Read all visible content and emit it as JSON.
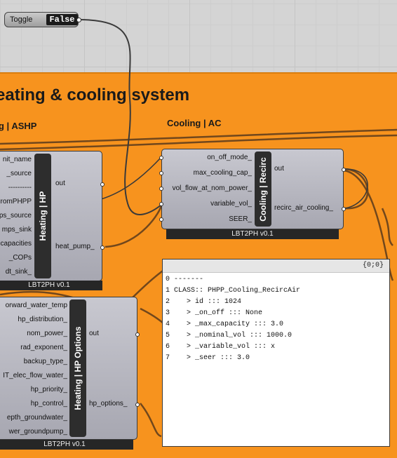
{
  "toggle": {
    "label": "Toggle",
    "value": "False"
  },
  "group": {
    "title": "eating & cooling system",
    "left_subtitle": "g | ASHP",
    "right_subtitle": "Cooling | AC"
  },
  "heating_hp": {
    "inputs": [
      "nit_name",
      "_source",
      "----------",
      "romPHPP",
      "ps_source",
      "mps_sink",
      "capacities",
      "_COPs",
      "dt_sink_"
    ],
    "outputs": [
      "out",
      "heat_pump_"
    ],
    "title": "Heating | HP",
    "footer": "LBT2PH v0.1"
  },
  "cooling_recirc": {
    "inputs": [
      "on_off_mode_",
      "max_cooling_cap_",
      "vol_flow_at_nom_power_",
      "variable_vol_",
      "SEER_"
    ],
    "outputs": [
      "out",
      "recirc_air_cooling_"
    ],
    "title": "Cooling | Recirc",
    "footer": "LBT2PH v0.1"
  },
  "heating_hp_options": {
    "inputs": [
      "orward_water_temp",
      "hp_distribution_",
      "nom_power_",
      "rad_exponent_",
      "backup_type_",
      "IT_elec_flow_water_",
      "hp_priority_",
      "hp_control_",
      "epth_groundwater_",
      "wer_groundpump_"
    ],
    "outputs": [
      "out",
      "hp_options_"
    ],
    "title": "Heating | HP Options",
    "footer": "LBT2PH v0.1"
  },
  "panel": {
    "path": "{0;0}",
    "rows": [
      {
        "i": "0",
        "t": "-------"
      },
      {
        "i": "1",
        "t": "CLASS:: PHPP_Cooling_RecircAir"
      },
      {
        "i": "2",
        "t": "   > id ::: 1024"
      },
      {
        "i": "3",
        "t": "   > _on_off ::: None"
      },
      {
        "i": "4",
        "t": "   > _max_capacity ::: 3.0"
      },
      {
        "i": "5",
        "t": "   > _nominal_vol ::: 1000.0"
      },
      {
        "i": "6",
        "t": "   > _variable_vol ::: x"
      },
      {
        "i": "7",
        "t": "   > _seer ::: 3.0"
      }
    ]
  }
}
